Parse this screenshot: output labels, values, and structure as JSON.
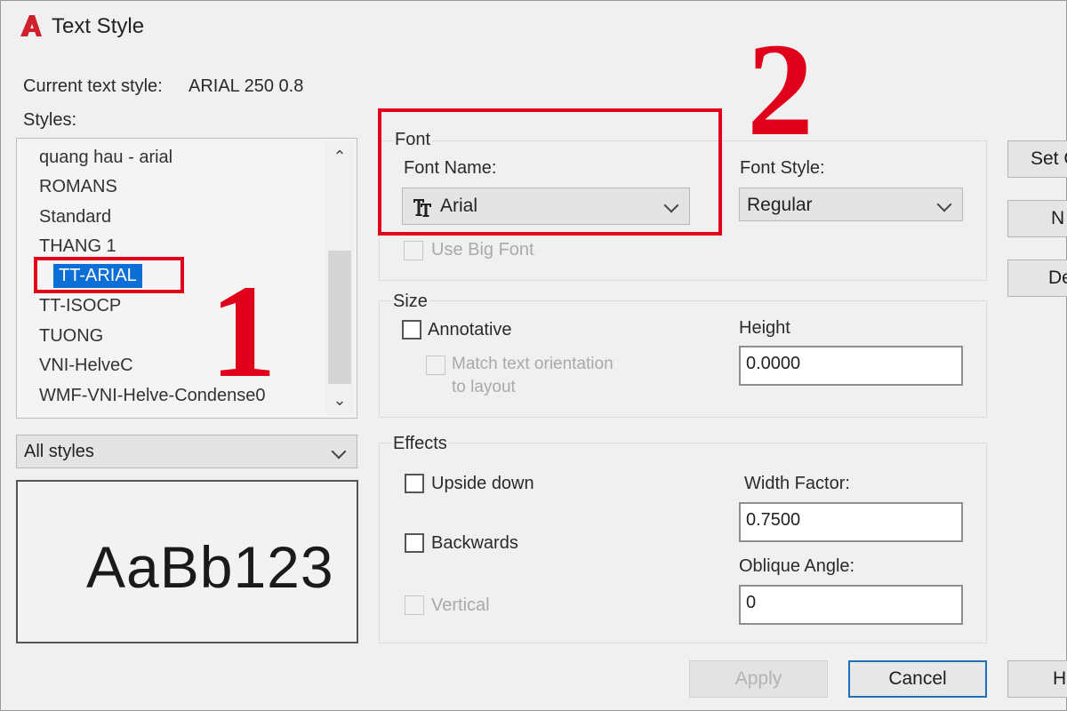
{
  "window": {
    "title": "Text Style",
    "app_icon": "autocad-logo-icon",
    "accent_color": "#0b6fd6"
  },
  "current": {
    "label": "Current text style:",
    "value": "ARIAL 250 0.8"
  },
  "styles": {
    "label": "Styles:",
    "items": [
      "quang hau - arial",
      "ROMANS",
      "Standard",
      "THANG 1",
      "TT-ARIAL",
      "TT-ISOCP",
      "TUONG",
      "VNI-HelveC",
      "WMF-VNI-Helve-Condense0"
    ],
    "selected": "TT-ARIAL",
    "filter": "All styles"
  },
  "preview": {
    "text": "AaBb123"
  },
  "font": {
    "group_label": "Font",
    "name_label": "Font Name:",
    "name_value": "Arial",
    "style_label": "Font Style:",
    "style_value": "Regular",
    "big_font_label": "Use Big Font"
  },
  "size": {
    "group_label": "Size",
    "annotative_label": "Annotative",
    "match_label_line1": "Match text orientation",
    "match_label_line2": "to layout",
    "height_label": "Height",
    "height_value": "0.0000"
  },
  "effects": {
    "group_label": "Effects",
    "upside_down": "Upside down",
    "backwards": "Backwards",
    "vertical": "Vertical",
    "width_factor_label": "Width Factor:",
    "width_factor_value": "0.7500",
    "oblique_label": "Oblique Angle:",
    "oblique_value": "0"
  },
  "side_buttons": {
    "set_current": "Set C",
    "new": "N",
    "delete": "De"
  },
  "bottom_buttons": {
    "apply": "Apply",
    "cancel": "Cancel",
    "help": "H"
  },
  "annotations": {
    "number_1": "1",
    "number_2": "2",
    "color": "#e1001c"
  }
}
